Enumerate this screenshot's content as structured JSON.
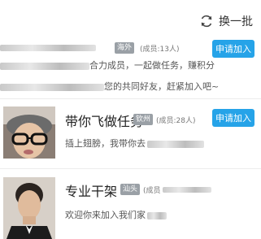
{
  "header": {
    "swap_label": "换一批"
  },
  "groups": [
    {
      "name": "",
      "region": "海外",
      "members": "(成员:13人)",
      "join_label": "申请加入",
      "desc_line1": "合力成员，一起做任务，赚积分",
      "desc_line2": "您的共同好友，赶紧加入吧~"
    },
    {
      "name": "带你飞做任务",
      "region": "钦州",
      "members": "(成员:28人)",
      "join_label": "申请加入",
      "desc_line1": "插上翅膀，我带你去"
    },
    {
      "name": "专业干架",
      "region": "汕头",
      "members": "(成员",
      "desc_line1": "欢迎你来加入我们家"
    }
  ],
  "colors": {
    "accent": "#26a3e8",
    "badge": "#9aa0a6"
  }
}
